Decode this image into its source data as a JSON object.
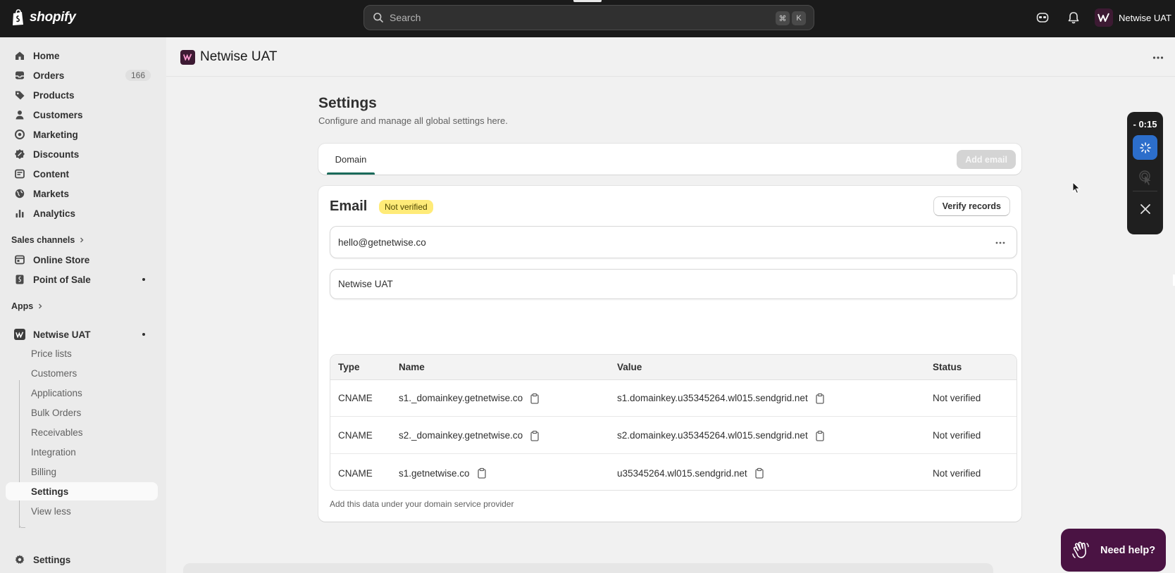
{
  "topbar": {
    "brand": "shopify",
    "search_placeholder": "Search",
    "shortcut_cmd": "⌘",
    "shortcut_key": "K",
    "store_name": "Netwise UAT"
  },
  "sidebar": {
    "items": [
      {
        "label": "Home"
      },
      {
        "label": "Orders",
        "badge": "166"
      },
      {
        "label": "Products"
      },
      {
        "label": "Customers"
      },
      {
        "label": "Marketing"
      },
      {
        "label": "Discounts"
      },
      {
        "label": "Content"
      },
      {
        "label": "Markets"
      },
      {
        "label": "Analytics"
      }
    ],
    "sales_channels_label": "Sales channels",
    "sales_channels": [
      {
        "label": "Online Store"
      },
      {
        "label": "Point of Sale"
      }
    ],
    "apps_label": "Apps",
    "app": {
      "label": "Netwise UAT"
    },
    "app_sub_items": [
      {
        "label": "Price lists"
      },
      {
        "label": "Customers"
      },
      {
        "label": "Applications"
      },
      {
        "label": "Bulk Orders"
      },
      {
        "label": "Receivables"
      },
      {
        "label": "Integration"
      },
      {
        "label": "Billing"
      },
      {
        "label": "Settings"
      },
      {
        "label": "View less"
      }
    ],
    "settings_label": "Settings"
  },
  "app_header": {
    "title": "Netwise UAT"
  },
  "page": {
    "title": "Settings",
    "subtitle": "Configure and manage all global settings here."
  },
  "tabs": {
    "items": [
      {
        "label": "Domain"
      }
    ],
    "add_email_label": "Add email"
  },
  "email_card": {
    "heading": "Email",
    "status_badge": "Not verified",
    "verify_label": "Verify records",
    "email_value": "hello@getnetwise.co",
    "sender_name": "Netwise UAT",
    "table": {
      "headers": [
        "Type",
        "Name",
        "Value",
        "Status"
      ],
      "rows": [
        {
          "type": "CNAME",
          "name": "s1._domainkey.getnetwise.co",
          "value": "s1.domainkey.u35345264.wl015.sendgrid.net",
          "status": "Not verified"
        },
        {
          "type": "CNAME",
          "name": "s2._domainkey.getnetwise.co",
          "value": "s2.domainkey.u35345264.wl015.sendgrid.net",
          "status": "Not verified"
        },
        {
          "type": "CNAME",
          "name": "s1.getnetwise.co",
          "value": "u35345264.wl015.sendgrid.net",
          "status": "Not verified"
        }
      ]
    },
    "footer_note": "Add this data under your domain service provider"
  },
  "recorder": {
    "time": "- 0:15"
  },
  "help": {
    "label": "Need help?"
  },
  "colors": {
    "topbar": "#1a1a1a",
    "accent_tab": "#1a6a5a",
    "warning_badge": "#ffeb78",
    "help_button": "#4a1343",
    "recorder_active": "#2c6ecb"
  }
}
